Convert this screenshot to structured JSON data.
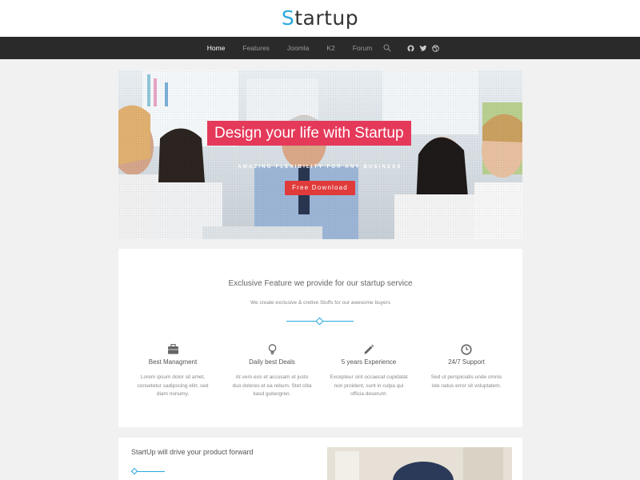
{
  "brand": {
    "logo_initial": "S",
    "logo_rest": "tartup"
  },
  "nav": {
    "items": [
      {
        "label": "Home",
        "active": true
      },
      {
        "label": "Features",
        "active": false
      },
      {
        "label": "Joomla",
        "active": false
      },
      {
        "label": "K2",
        "active": false
      },
      {
        "label": "Forum",
        "active": false
      }
    ],
    "icons": [
      "search-icon",
      "github-icon",
      "twitter-icon",
      "dribbble-icon"
    ]
  },
  "hero": {
    "title": "Design your life with Startup",
    "subtitle": "AMAZING FLEXIBILITY FOR ANY BUSINESS",
    "button_label": "Free Download"
  },
  "features": {
    "heading": "Exclusive Feature we provide for our startup service",
    "subheading": "We create exclusive & cretive Stuffs for our awesome buyers",
    "items": [
      {
        "icon": "briefcase-icon",
        "title": "Best Managment",
        "text": "Lorem ipsum dolor sit amet, consetetur sadipscing elitr, sed diam nonumy."
      },
      {
        "icon": "lightbulb-icon",
        "title": "Daily best Deals",
        "text": "At vero eos et accusam et justo duo dolores et ea rebum. Stet clita kasd gubergren."
      },
      {
        "icon": "pencil-icon",
        "title": "5 years Experience",
        "text": "Excepteur sint occaecat cupidatat non proident, sunt in culpa qui officia deserunt."
      },
      {
        "icon": "clock-icon",
        "title": "24/7 Support",
        "text": "Sed ut perspiciatis unde omnis iste natus error sit voluptatem."
      }
    ]
  },
  "section2": {
    "title": "StartUp will drive your product forward"
  },
  "colors": {
    "accent": "#29a8e0",
    "hero_title_bg": "#e5395a",
    "button_bg": "#e03a3a",
    "navbar_bg": "#2a2a2a"
  }
}
